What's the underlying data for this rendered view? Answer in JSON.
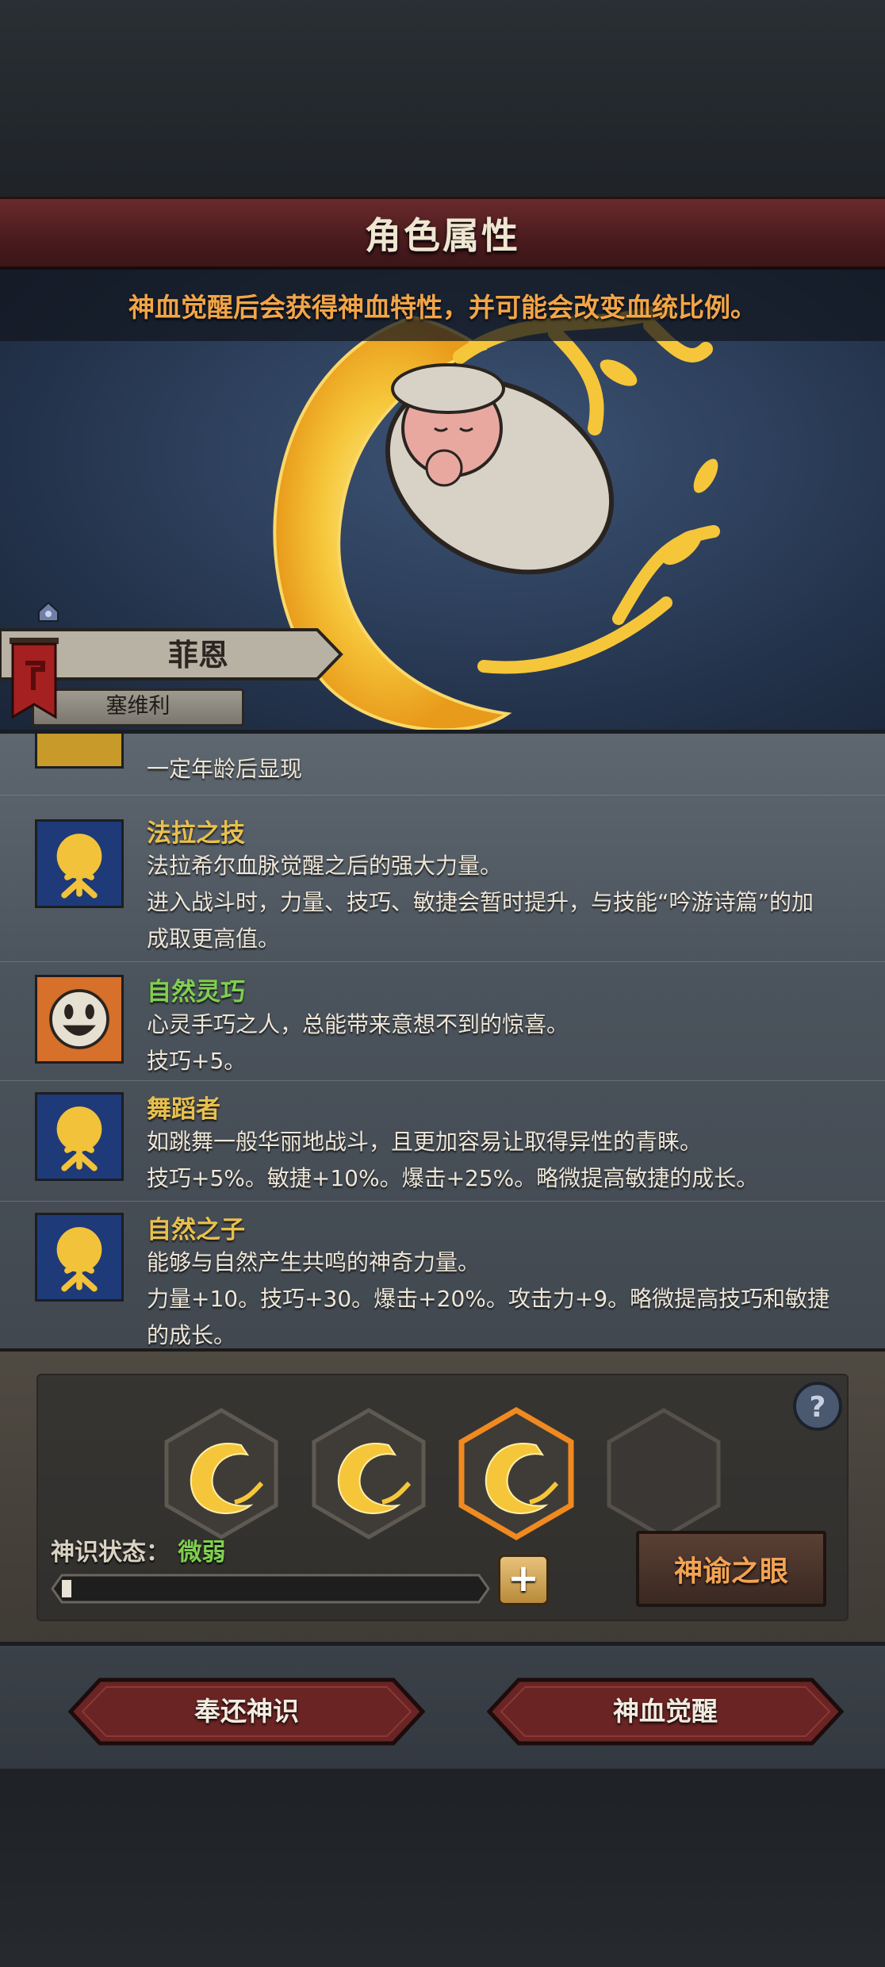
{
  "header": {
    "title": "角色属性"
  },
  "hint": "神血觉醒后会获得神血特性，并可能会改变血统比例。",
  "character": {
    "name": "菲恩",
    "origin": "塞维利"
  },
  "traits": [
    {
      "name": "",
      "lines": [
        "一定年龄后显现"
      ],
      "color": "gold",
      "icon": "locked-trait-icon"
    },
    {
      "name": "法拉之技",
      "lines": [
        "法拉希尔血脉觉醒之后的强大力量。",
        "进入战斗时，力量、技巧、敏捷会暂时提升，与技能“吟游诗篇”的加",
        "成取更高值。"
      ],
      "color": "gold",
      "icon": "golden-tree-icon"
    },
    {
      "name": "自然灵巧",
      "lines": [
        "心灵手巧之人，总能带来意想不到的惊喜。",
        "技巧+5。"
      ],
      "color": "green",
      "icon": "smiley-face-icon"
    },
    {
      "name": "舞蹈者",
      "lines": [
        "如跳舞一般华丽地战斗，且更加容易让取得异性的青睐。",
        "技巧+5%。敏捷+10%。爆击+25%。略微提高敏捷的成长。"
      ],
      "color": "gold",
      "icon": "golden-tree-icon"
    },
    {
      "name": "自然之子",
      "lines": [
        "能够与自然产生共鸣的神奇力量。",
        "力量+10。技巧+30。爆击+20%。攻击力+9。略微提高技巧和敏捷",
        "的成长。"
      ],
      "color": "gold",
      "icon": "golden-tree-icon"
    }
  ],
  "awakening": {
    "status_label": "神识状态：",
    "status_value": "微弱",
    "progress": 0.02,
    "slots": [
      "filled",
      "filled",
      "selected",
      "empty"
    ],
    "oracle_button": "神谕之眼",
    "plus_label": "+"
  },
  "footer": {
    "return_button": "奉还神识",
    "awaken_button": "神血觉醒"
  },
  "colors": {
    "gold": "#e7c04e",
    "green": "#7ed04f",
    "accent_orange": "#f2a548"
  }
}
